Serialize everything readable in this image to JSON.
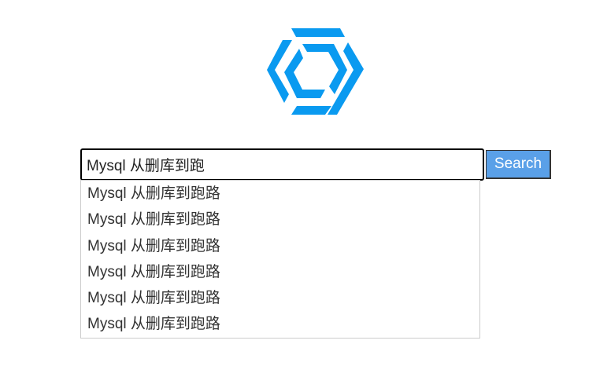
{
  "logo": {
    "icon": "hexagon-swirl-logo",
    "color": "#0a9af0"
  },
  "search": {
    "value": "Mysql 从删库到跑",
    "button_label": "Search",
    "button_color": "#5aa0e8"
  },
  "suggestions": [
    {
      "text": "Mysql 从删库到跑路"
    },
    {
      "text": "Mysql 从删库到跑路"
    },
    {
      "text": "Mysql 从删库到跑路"
    },
    {
      "text": "Mysql 从删库到跑路"
    },
    {
      "text": "Mysql 从删库到跑路"
    },
    {
      "text": "Mysql 从删库到跑路"
    }
  ]
}
